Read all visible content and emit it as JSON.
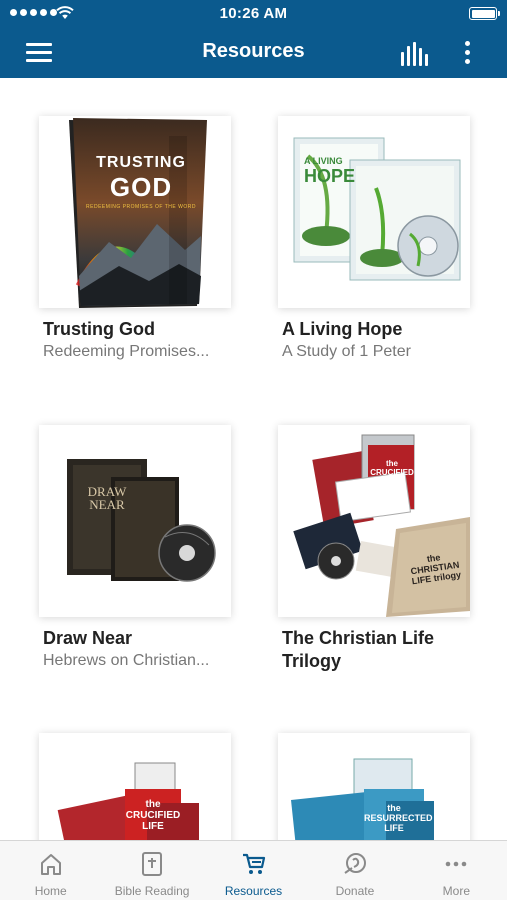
{
  "status": {
    "time": "10:26 AM"
  },
  "nav": {
    "title": "Resources"
  },
  "colors": {
    "brand": "#0b5a8e",
    "card_title": "#222222",
    "card_subtitle": "#777777",
    "tab_inactive": "#8a8a8a"
  },
  "icons": [
    "hamburger-menu-icon",
    "bar-chart-icon",
    "vertical-more-icon",
    "home-icon",
    "bible-icon",
    "cart-icon",
    "donate-icon",
    "more-dots-icon"
  ],
  "resources": [
    {
      "title": "Trusting God",
      "subtitle": "Redeeming Promises...",
      "cover_title_1": "TRUSTING",
      "cover_title_2": "GOD",
      "cover_tagline": "REDEEMING PROMISES OF THE WORD"
    },
    {
      "title": "A Living Hope",
      "subtitle": "A Study of 1 Peter",
      "cover_title_1": "A LIVING",
      "cover_title_2": "HOPE"
    },
    {
      "title": "Draw Near",
      "subtitle": "Hebrews on Christian...",
      "cover_title_1": "DRAW",
      "cover_title_2": "NEAR"
    },
    {
      "title": "The Christian Life Trilogy",
      "subtitle": "",
      "cover_title_1": "the CRUCIFIED LIFE",
      "cover_title_2": "the CHRISTIAN LIFE trilogy"
    },
    {
      "title": "",
      "subtitle": "",
      "cover_title_1": "the CRUCIFIED LIFE"
    },
    {
      "title": "",
      "subtitle": "",
      "cover_title_1": "the RESURRECTED LIFE"
    }
  ],
  "tabs": [
    {
      "label": "Home",
      "icon": "home-icon",
      "active": false
    },
    {
      "label": "Bible Reading",
      "icon": "bible-icon",
      "active": false
    },
    {
      "label": "Resources",
      "icon": "cart-icon",
      "active": true
    },
    {
      "label": "Donate",
      "icon": "donate-icon",
      "active": false
    },
    {
      "label": "More",
      "icon": "more-dots-icon",
      "active": false
    }
  ]
}
